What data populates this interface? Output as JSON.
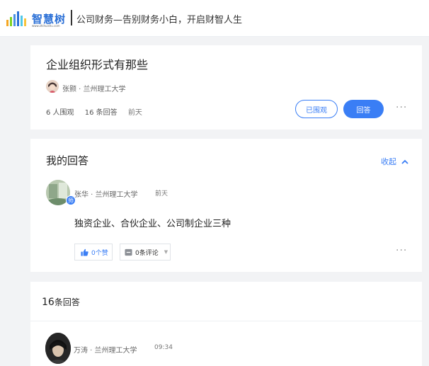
{
  "header": {
    "logo_text": "智慧树",
    "logo_url": "www.zhihuishu.com",
    "slogan": "公司财务—告别财务小白，开启财智人生"
  },
  "question": {
    "title": "企业组织形式有那些",
    "author": "张颢 · 兰州理工大学",
    "followers": "6 人围观",
    "answers": "16 条回答",
    "time": "前天",
    "followed_label": "已围观",
    "answer_label": "回答",
    "more": "···"
  },
  "my_answer": {
    "section_title": "我的回答",
    "collapse_label": "收起",
    "badge": "师",
    "author": "张华 · 兰州理工大学",
    "time": "前天",
    "body": "独资企业、合伙企业、公司制企业三种",
    "like_label": "0个赞",
    "comment_label": "0条评论",
    "more": "···"
  },
  "answers_list": {
    "count": "16",
    "count_suffix": "条回答",
    "items": [
      {
        "author": "万涛 · 兰州理工大学",
        "time": "09:34"
      }
    ]
  },
  "colors": {
    "accent": "#3a7ef5",
    "background": "#f2f3f5"
  }
}
